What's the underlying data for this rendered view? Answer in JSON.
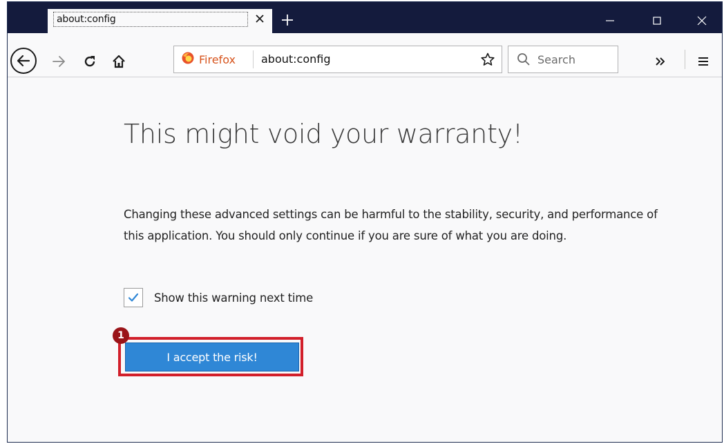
{
  "tab": {
    "title": "about:config",
    "close_icon": "close-icon"
  },
  "toolbar": {
    "identity_label": "Firefox",
    "url": "about:config",
    "search_placeholder": "Search",
    "icons": [
      "back-icon",
      "forward-icon",
      "reload-icon",
      "home-icon",
      "firefox-logo-icon",
      "bookmark-star-icon",
      "search-icon",
      "overflow-icon",
      "menu-icon"
    ]
  },
  "window_controls": [
    "minimize-icon",
    "maximize-icon",
    "close-window-icon"
  ],
  "main": {
    "heading": "This might void your warranty!",
    "warning_text": "Changing these advanced settings can be harmful to the stability, security, and performance of this application. You should only continue if you are sure of what you are doing.",
    "checkbox_label": "Show this warning next time",
    "checkbox_checked": true,
    "accept_button_label": "I accept the risk!"
  },
  "annotation": {
    "step_number": "1",
    "highlight_color": "#d21f2a",
    "badge_color": "#9a1418"
  },
  "colors": {
    "titlebar": "#141b3d",
    "accent_button": "#2f87d6",
    "identity": "#d7541d",
    "checkmark": "#2f87d6"
  }
}
